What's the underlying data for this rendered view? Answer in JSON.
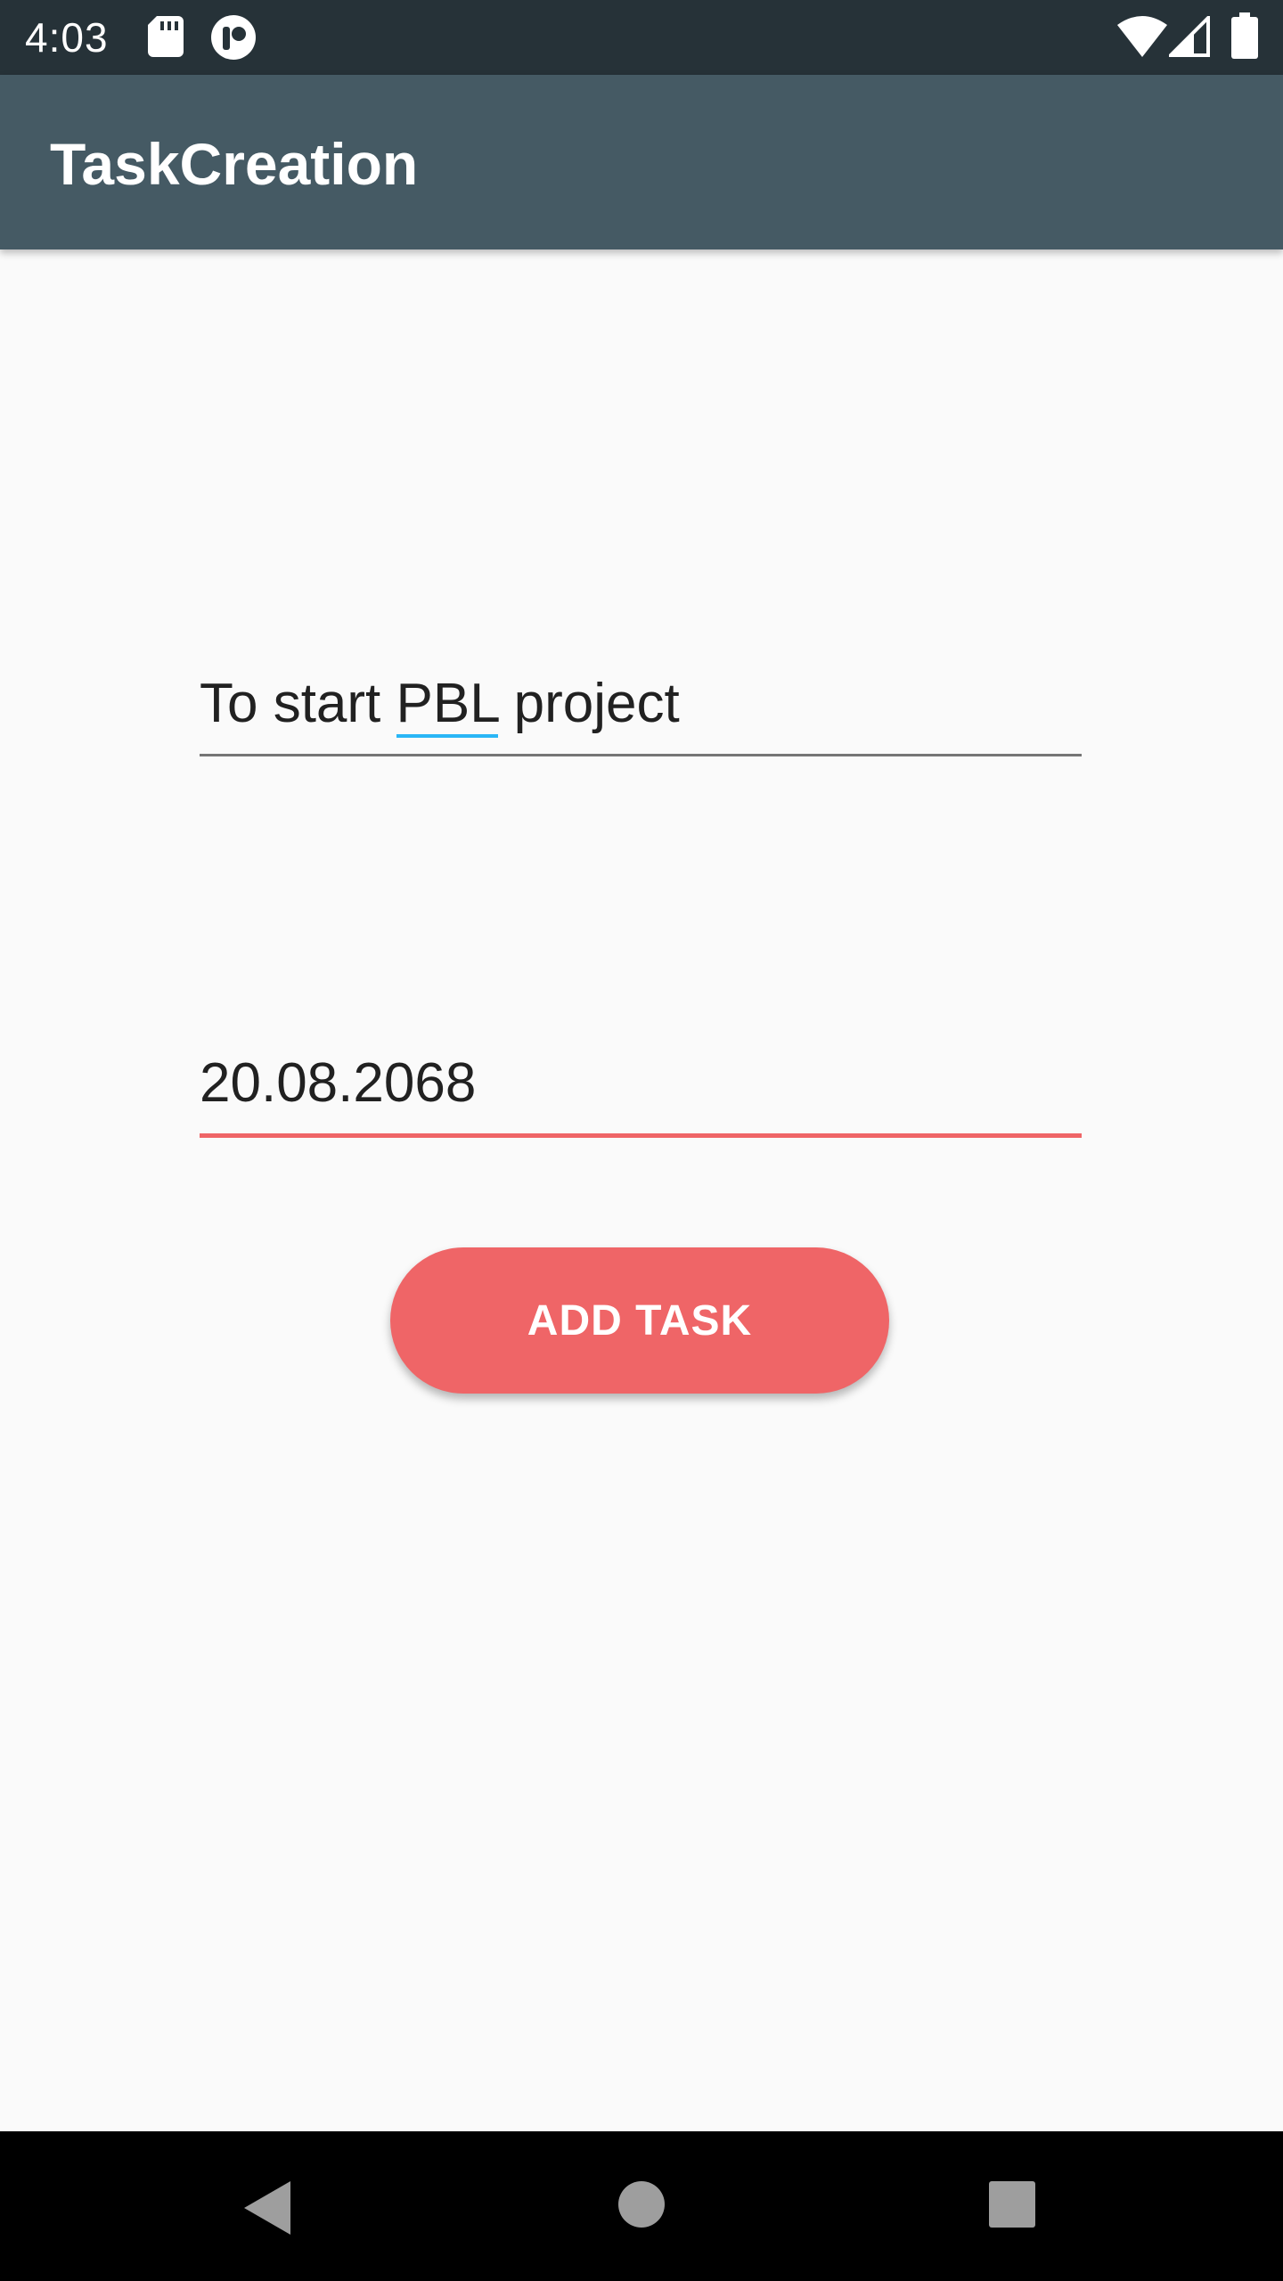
{
  "status_bar": {
    "time": "4:03",
    "icons": [
      "sd-card-icon",
      "ninja-app-icon",
      "wifi-icon",
      "signal-icon",
      "battery-icon"
    ]
  },
  "app_bar": {
    "title": "TaskCreation"
  },
  "form": {
    "task_field": {
      "value_before": "To start ",
      "value_spell": "PBL",
      "value_after": " project"
    },
    "date_field": {
      "value": "20.08.2068"
    },
    "add_button_label": "ADD TASK"
  },
  "nav_bar": {
    "icons": [
      "back-icon",
      "home-icon",
      "recents-icon"
    ]
  },
  "colors": {
    "status_bar": "#263238",
    "app_bar": "#455a64",
    "accent": "#ef6567",
    "spellcheck_underline": "#29b6f6",
    "background": "#fafafa"
  }
}
